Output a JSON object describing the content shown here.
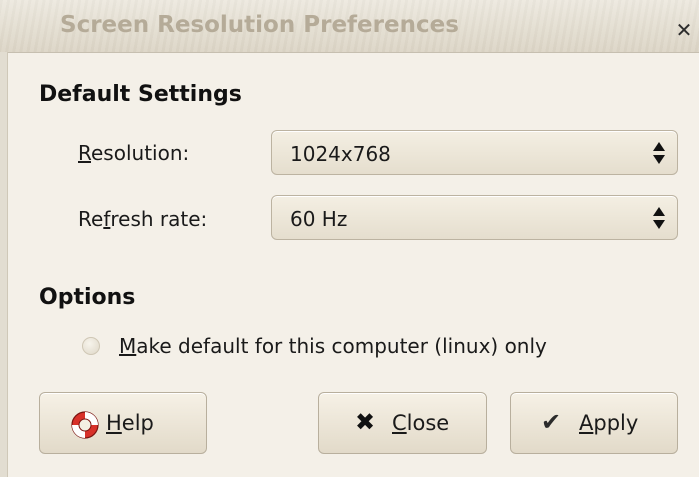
{
  "window": {
    "title": "Screen Resolution Preferences",
    "close_glyph": "✕"
  },
  "default_settings": {
    "heading": "Default Settings",
    "resolution": {
      "label_mnemonic": "R",
      "label_rest": "esolution:",
      "value": "1024x768"
    },
    "refresh_rate": {
      "label_before": "Re",
      "label_mnemonic": "f",
      "label_after": "resh rate:",
      "value": "60 Hz"
    }
  },
  "options": {
    "heading": "Options",
    "make_default": {
      "label_mnemonic": "M",
      "label_rest": "ake default for this computer (linux) only",
      "checked": false
    }
  },
  "buttons": {
    "help": {
      "mnemonic": "H",
      "rest": "elp",
      "icon": "lifebuoy-icon"
    },
    "close": {
      "mnemonic": "C",
      "rest": "lose",
      "icon": "close-icon",
      "glyph": "✖"
    },
    "apply": {
      "mnemonic": "A",
      "rest": "pply",
      "icon": "checkmark-icon",
      "glyph": "✔"
    }
  }
}
